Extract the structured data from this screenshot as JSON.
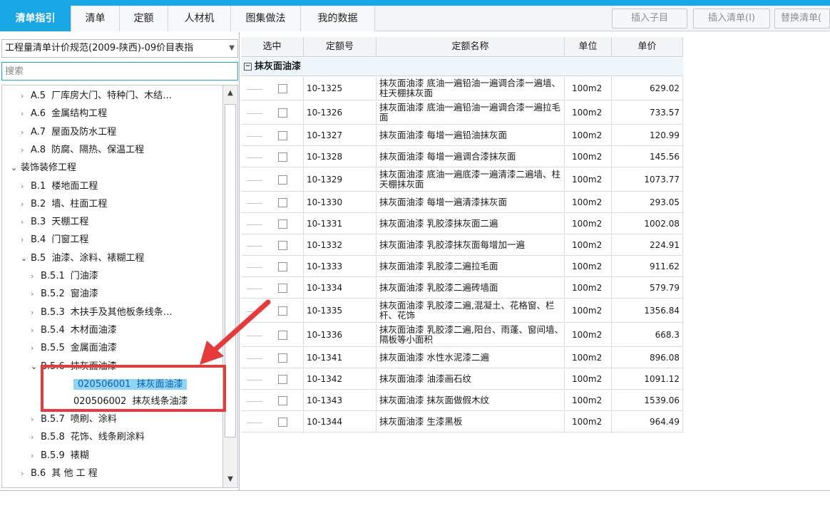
{
  "tabs": [
    {
      "label": "清单指引",
      "active": true
    },
    {
      "label": "清单",
      "active": false
    },
    {
      "label": "定额",
      "active": false
    },
    {
      "label": "人材机",
      "active": false
    },
    {
      "label": "图集做法",
      "active": false
    },
    {
      "label": "我的数据",
      "active": false
    }
  ],
  "toolbar": {
    "insert_child": "插入子目",
    "insert_list": "插入清单(I)",
    "replace_list": "替换清单("
  },
  "left": {
    "spec_select": "工程量清单计价规范(2009-陕西)-09价目表指",
    "search_placeholder": "搜索",
    "tree": [
      {
        "code": "A.5",
        "label": "厂库房大门、特种门、木结…",
        "level": 1,
        "expanded": false
      },
      {
        "code": "A.6",
        "label": "金属结构工程",
        "level": 1,
        "expanded": false
      },
      {
        "code": "A.7",
        "label": "屋面及防水工程",
        "level": 1,
        "expanded": false
      },
      {
        "code": "A.8",
        "label": "防腐、隔热、保温工程",
        "level": 1,
        "expanded": false
      },
      {
        "code": "",
        "label": "装饰装修工程",
        "level": 0,
        "expanded": true
      },
      {
        "code": "B.1",
        "label": "楼地面工程",
        "level": 1,
        "expanded": false
      },
      {
        "code": "B.2",
        "label": "墙、柱面工程",
        "level": 1,
        "expanded": false
      },
      {
        "code": "B.3",
        "label": "天棚工程",
        "level": 1,
        "expanded": false
      },
      {
        "code": "B.4",
        "label": "门窗工程",
        "level": 1,
        "expanded": false
      },
      {
        "code": "B.5",
        "label": "油漆、涂料、裱糊工程",
        "level": 1,
        "expanded": true
      },
      {
        "code": "B.5.1",
        "label": "门油漆",
        "level": 2,
        "expanded": false
      },
      {
        "code": "B.5.2",
        "label": "窗油漆",
        "level": 2,
        "expanded": false
      },
      {
        "code": "B.5.3",
        "label": "木扶手及其他板条线条…",
        "level": 2,
        "expanded": false
      },
      {
        "code": "B.5.4",
        "label": "木材面油漆",
        "level": 2,
        "expanded": false
      },
      {
        "code": "B.5.5",
        "label": "金属面油漆",
        "level": 2,
        "expanded": false
      },
      {
        "code": "B.5.6",
        "label": "抹灰面油漆",
        "level": 2,
        "expanded": true
      },
      {
        "code": "020506001",
        "label": "抹灰面油漆",
        "level": 3,
        "selected": true
      },
      {
        "code": "020506002",
        "label": "抹灰线条油漆",
        "level": 3,
        "selected": false
      },
      {
        "code": "B.5.7",
        "label": "喷刷、涂料",
        "level": 2,
        "expanded": false
      },
      {
        "code": "B.5.8",
        "label": "花饰、线条刷涂料",
        "level": 2,
        "expanded": false
      },
      {
        "code": "B.5.9",
        "label": "裱糊",
        "level": 2,
        "expanded": false
      },
      {
        "code": "B.6",
        "label": "其 他 工 程",
        "level": 1,
        "expanded": false
      }
    ]
  },
  "grid": {
    "headers": {
      "select": "选中",
      "code": "定额号",
      "name": "定额名称",
      "unit": "单位",
      "price": "单价"
    },
    "group_label": "抹灰面油漆",
    "rows": [
      {
        "code": "10-1325",
        "name": "抹灰面油漆 底油一遍铅油一遍调合漆一遍墙、柱天棚抹灰面",
        "unit": "100m2",
        "price": "629.02",
        "tall": true
      },
      {
        "code": "10-1326",
        "name": "抹灰面油漆 底油一遍铅油一遍调合漆一遍拉毛面",
        "unit": "100m2",
        "price": "733.57",
        "tall": true
      },
      {
        "code": "10-1327",
        "name": "抹灰面油漆 每增一遍铅油抹灰面",
        "unit": "100m2",
        "price": "120.99",
        "tall": false
      },
      {
        "code": "10-1328",
        "name": "抹灰面油漆 每增一遍调合漆抹灰面",
        "unit": "100m2",
        "price": "145.56",
        "tall": false
      },
      {
        "code": "10-1329",
        "name": "抹灰面油漆 底油一遍底漆一遍清漆二遍墙、柱天棚抹灰面",
        "unit": "100m2",
        "price": "1073.77",
        "tall": true
      },
      {
        "code": "10-1330",
        "name": "抹灰面油漆 每增一遍清漆抹灰面",
        "unit": "100m2",
        "price": "293.05",
        "tall": false
      },
      {
        "code": "10-1331",
        "name": "抹灰面油漆 乳胶漆抹灰面二遍",
        "unit": "100m2",
        "price": "1002.08",
        "tall": false
      },
      {
        "code": "10-1332",
        "name": "抹灰面油漆 乳胶漆抹灰面每增加一遍",
        "unit": "100m2",
        "price": "224.91",
        "tall": false
      },
      {
        "code": "10-1333",
        "name": "抹灰面油漆 乳胶漆二遍拉毛面",
        "unit": "100m2",
        "price": "911.62",
        "tall": false
      },
      {
        "code": "10-1334",
        "name": "抹灰面油漆 乳胶漆二遍砖墙面",
        "unit": "100m2",
        "price": "579.79",
        "tall": false
      },
      {
        "code": "10-1335",
        "name": "抹灰面油漆 乳胶漆二遍,混凝土、花格窗、栏杆、花饰",
        "unit": "100m2",
        "price": "1356.84",
        "tall": true
      },
      {
        "code": "10-1336",
        "name": "抹灰面油漆 乳胶漆二遍,阳台、雨蓬、窗间墙、隔板等小面积",
        "unit": "100m2",
        "price": "668.3",
        "tall": true
      },
      {
        "code": "10-1341",
        "name": "抹灰面油漆 水性水泥漆二遍",
        "unit": "100m2",
        "price": "896.08",
        "tall": false
      },
      {
        "code": "10-1342",
        "name": "抹灰面油漆 油漆画石纹",
        "unit": "100m2",
        "price": "1091.12",
        "tall": false
      },
      {
        "code": "10-1343",
        "name": "抹灰面油漆 抹灰面做假木纹",
        "unit": "100m2",
        "price": "1539.06",
        "tall": false
      },
      {
        "code": "10-1344",
        "name": "抹灰面油漆 生漆黑板",
        "unit": "100m2",
        "price": "964.49",
        "tall": false
      }
    ]
  },
  "colors": {
    "accent": "#1aa7e6",
    "highlight": "#e53b3b",
    "selected_bg": "#8ed4f4"
  }
}
